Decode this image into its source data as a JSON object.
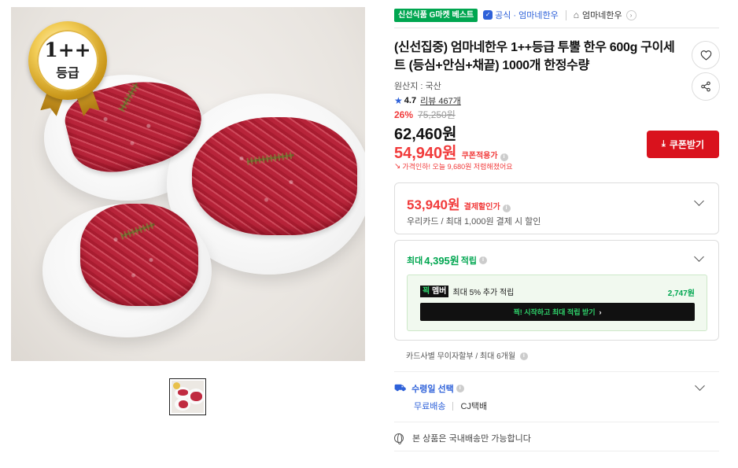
{
  "image": {
    "grade_badge_top": "1++",
    "grade_badge_bottom": "등급"
  },
  "header": {
    "best_badge": "신선식품 G마켓 베스트",
    "official_label": "공식 · 엄마네한우",
    "shop_name": "엄마네한우"
  },
  "product": {
    "title": "(신선집중) 엄마네한우 1++등급 투뿔 한우 600g 구이세트 (등심+안심+채끝) 1000개 한정수량",
    "origin": "원산지 : 국산",
    "rating": "4.7",
    "review_label": "리뷰 467개",
    "discount_rate": "26%",
    "original_price": "75,250원",
    "sale_price": "62,460원",
    "coupon_price": "54,940원",
    "coupon_price_label": "쿠폰적용가",
    "price_drop_note": "가격인하! 오늘 9,680원 저렴해졌어요",
    "coupon_button": "쿠폰받기"
  },
  "payment_discount": {
    "price": "53,940원",
    "label": "결제할인가",
    "detail": "우리카드 / 최대 1,000원 결제 시 할인"
  },
  "points": {
    "prefix": "최대",
    "amount": "4,395원",
    "suffix": "적립",
    "member_tag_a": "꾁",
    "member_tag_b": "멤버",
    "member_desc": "최대 5% 추가 적립",
    "member_points": "2,747원",
    "member_button": "꾁! 시작하고 최대 적립 받기"
  },
  "installment": {
    "text": "카드사별 무이자할부 / 최대 6개월"
  },
  "delivery": {
    "title": "수령일 선택",
    "shipping": "무료배송",
    "courier": "CJ택배"
  },
  "domestic_note": "본 상품은 국내배송만 가능합니다",
  "colors": {
    "accent_red": "#d9121d",
    "price_red": "#f13a3a",
    "point_green": "#00a650",
    "link_blue": "#2e61d9"
  }
}
